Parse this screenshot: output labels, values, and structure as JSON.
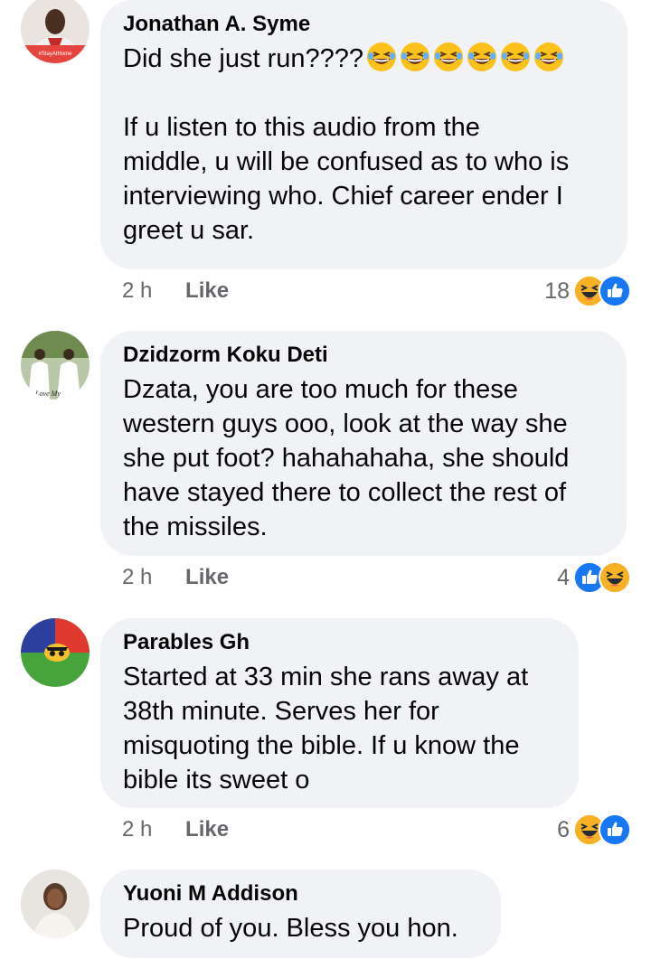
{
  "comments": [
    {
      "author": "Jonathan A. Syme",
      "text_line1": "Did she just run????",
      "emoji_count": 6,
      "text_rest": "If u listen to this audio from the\nmiddle, u will be confused as to who is\ninterviewing who. Chief career ender I\ngreet u sar.",
      "time": "2 h",
      "like_label": "Like",
      "reaction_count": "18",
      "reactions": [
        "haha-icon",
        "like-icon"
      ]
    },
    {
      "author": "Dzidzorm Koku Deti",
      "text": "Dzata, you are too much for these\nwestern guys ooo, look at the way she\nshe put foot? hahahahaha, she should\nhave stayed there to collect the rest of\nthe missiles.",
      "time": "2 h",
      "like_label": "Like",
      "reaction_count": "4",
      "reactions": [
        "like-icon",
        "haha-icon"
      ]
    },
    {
      "author": "Parables Gh",
      "text": "Started at 33 min she rans away at\n38th minute. Serves her for\nmisquoting the bible. If u know the\nbible its sweet o",
      "time": "2 h",
      "like_label": "Like",
      "reaction_count": "6",
      "reactions": [
        "haha-icon",
        "like-icon"
      ]
    },
    {
      "author": "Yuoni M Addison",
      "text": "Proud of you. Bless you hon."
    }
  ],
  "colors": {
    "bubble": "#f0f2f5",
    "meta": "#65676b",
    "like_blue": "#1877f2",
    "haha_yellow": "#f7b125"
  }
}
